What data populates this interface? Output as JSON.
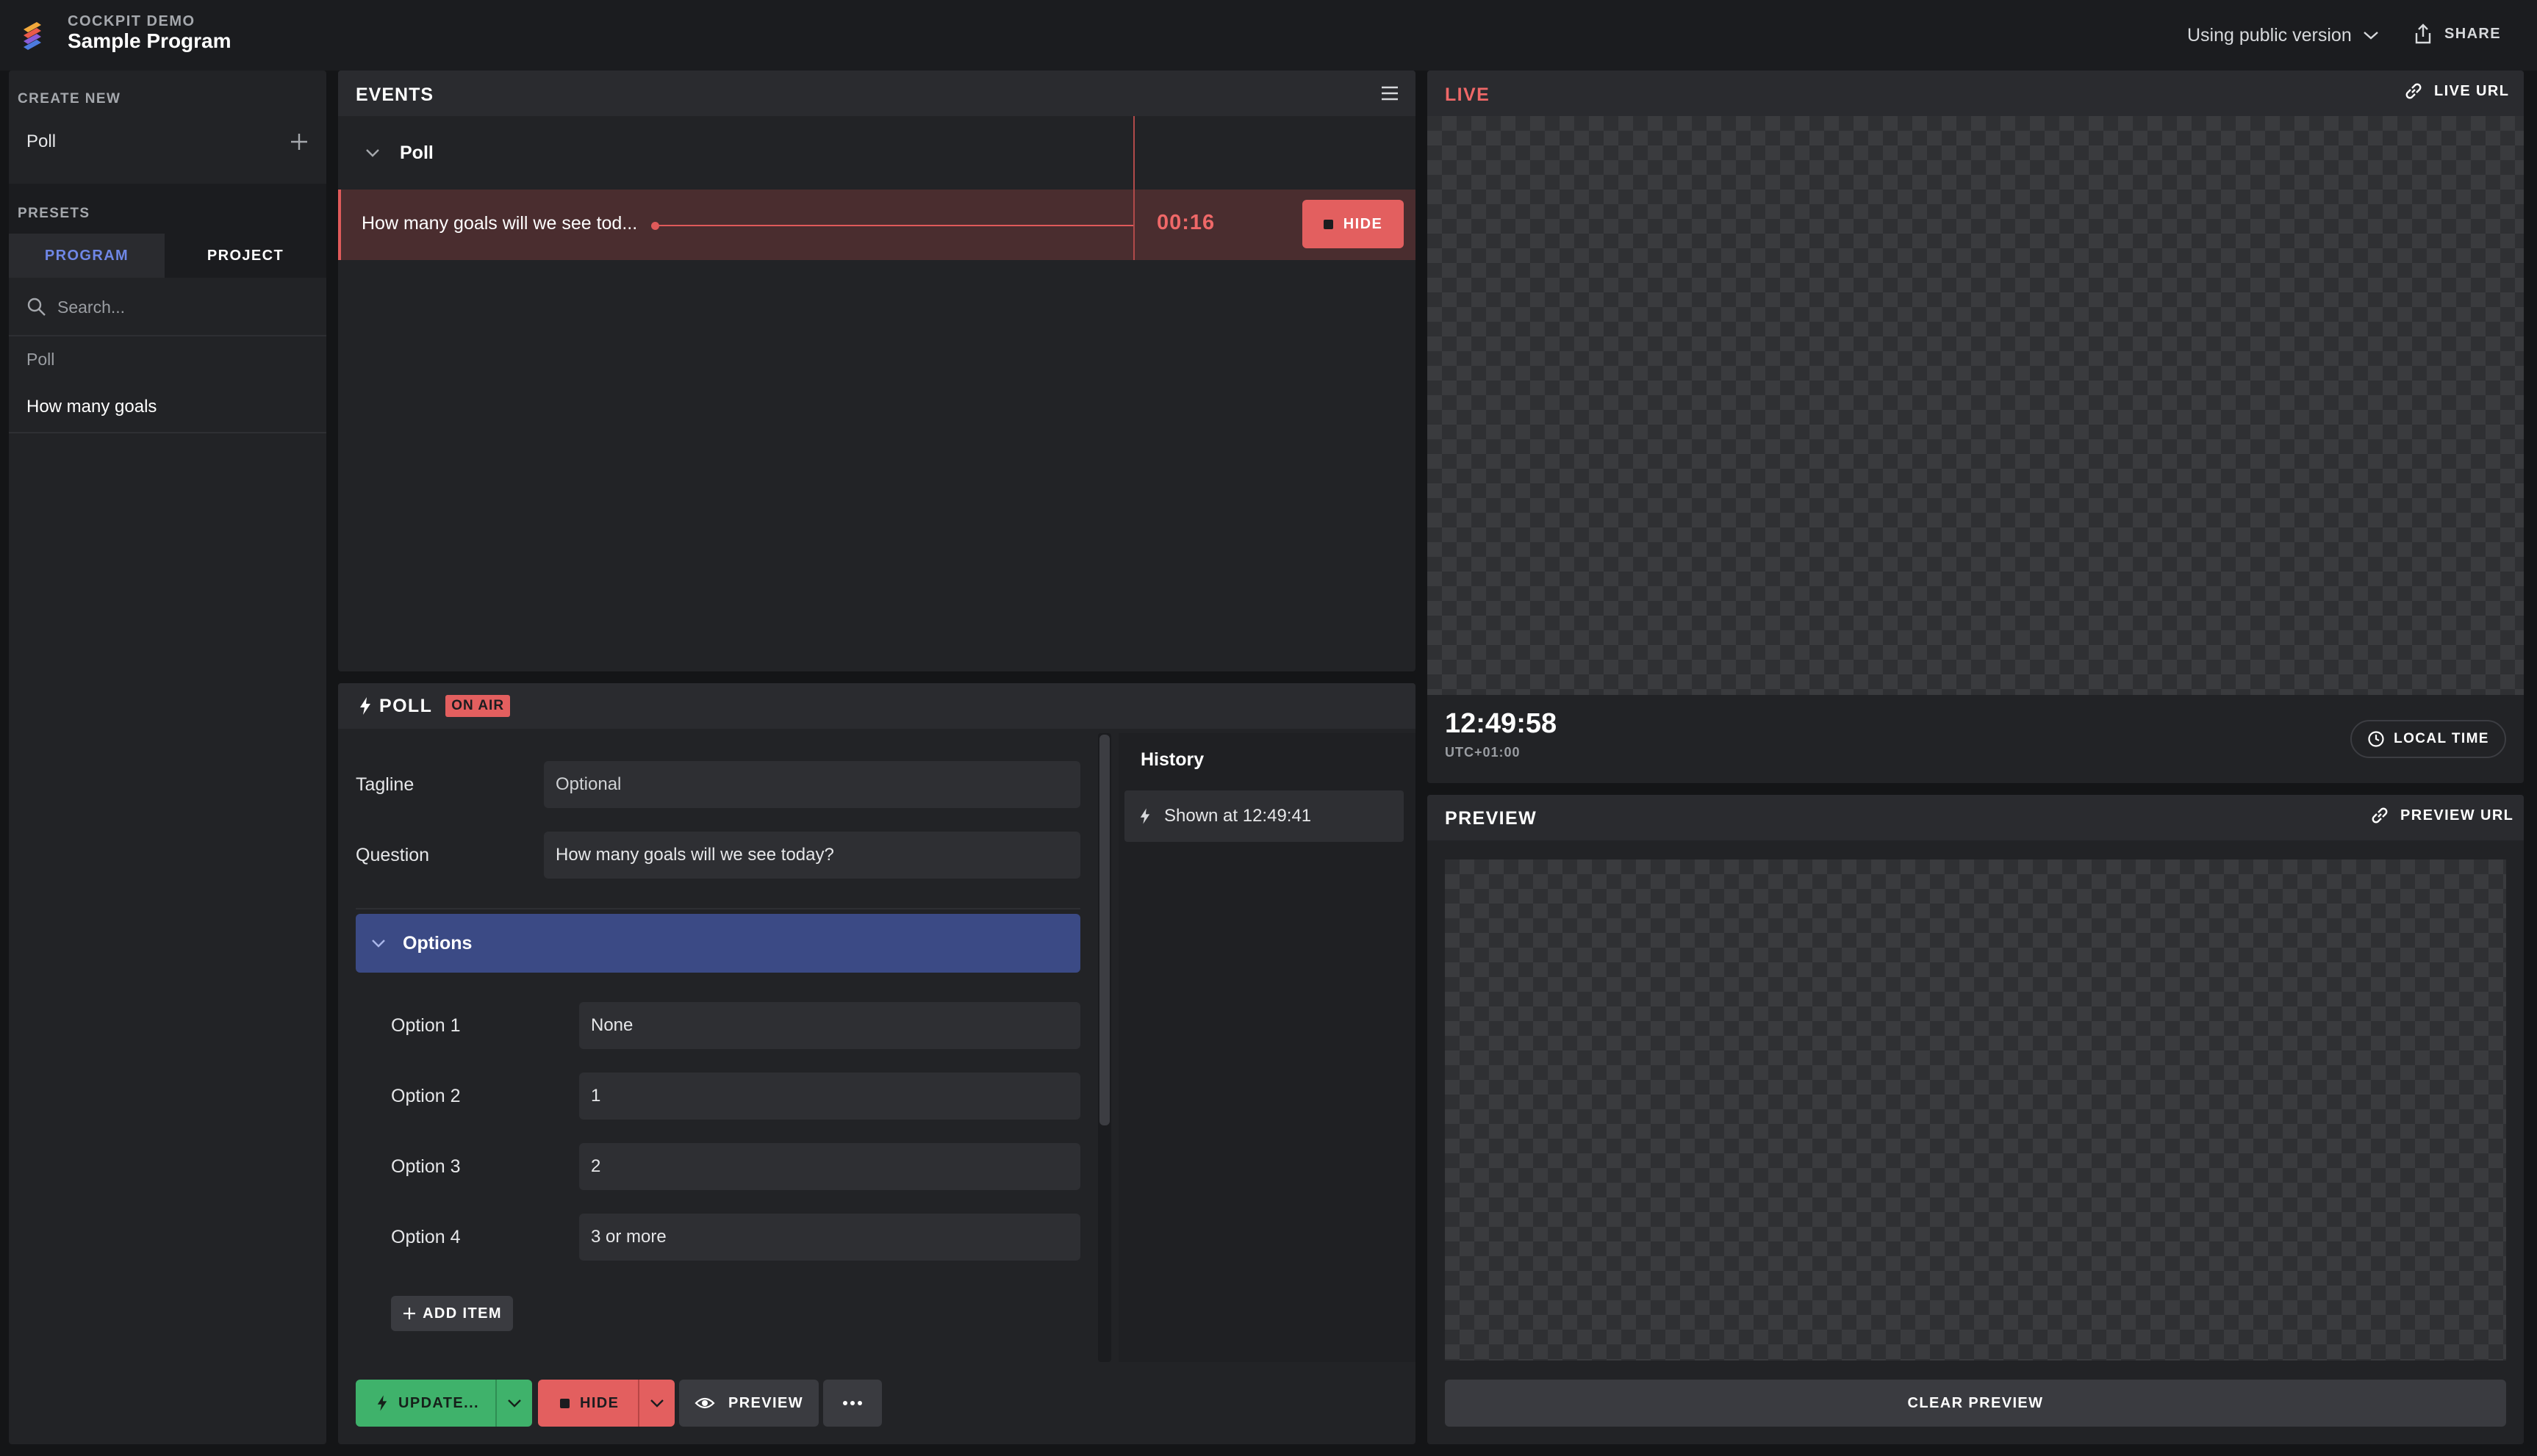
{
  "header": {
    "app_subtitle": "COCKPIT DEMO",
    "app_title": "Sample Program",
    "version_label": "Using public version",
    "share_label": "SHARE"
  },
  "sidebar": {
    "create_new_heading": "CREATE NEW",
    "create_items": [
      {
        "label": "Poll"
      }
    ],
    "presets_heading": "PRESETS",
    "tabs": [
      {
        "label": "PROGRAM",
        "active": true
      },
      {
        "label": "PROJECT",
        "active": false
      }
    ],
    "search_placeholder": "Search...",
    "preset_groups": [
      {
        "name": "Poll",
        "items": [
          {
            "label": "How many goals"
          }
        ]
      }
    ]
  },
  "events": {
    "title": "EVENTS",
    "group_name": "Poll",
    "rows": [
      {
        "label": "How many goals will we see tod...",
        "timer": "00:16",
        "action_label": "HIDE"
      }
    ]
  },
  "poll_editor": {
    "title": "POLL",
    "badge": "ON AIR",
    "fields": [
      {
        "label": "Tagline",
        "value": "",
        "placeholder": "Optional"
      },
      {
        "label": "Question",
        "value": "How many goals will we see today?",
        "placeholder": ""
      }
    ],
    "options_label": "Options",
    "options": [
      {
        "label": "Option 1",
        "value": "None"
      },
      {
        "label": "Option 2",
        "value": "1"
      },
      {
        "label": "Option 3",
        "value": "2"
      },
      {
        "label": "Option 4",
        "value": "3 or more"
      }
    ],
    "add_item_label": "ADD ITEM",
    "history_title": "History",
    "history_items": [
      {
        "label": "Shown at 12:49:41"
      }
    ],
    "actions": {
      "update_label": "UPDATE...",
      "hide_label": "HIDE",
      "preview_label": "PREVIEW",
      "more_label": "···"
    }
  },
  "live": {
    "title": "LIVE",
    "url_label": "LIVE URL",
    "clock": "12:49:58",
    "timezone": "UTC+01:00",
    "local_time_label": "LOCAL TIME"
  },
  "preview": {
    "title": "PREVIEW",
    "url_label": "PREVIEW URL",
    "clear_label": "CLEAR PREVIEW"
  },
  "colors": {
    "accent_blue": "#6f87e6",
    "live_red": "#e35f5f",
    "update_green": "#3fb26b",
    "options_bar": "#3b4a85"
  }
}
